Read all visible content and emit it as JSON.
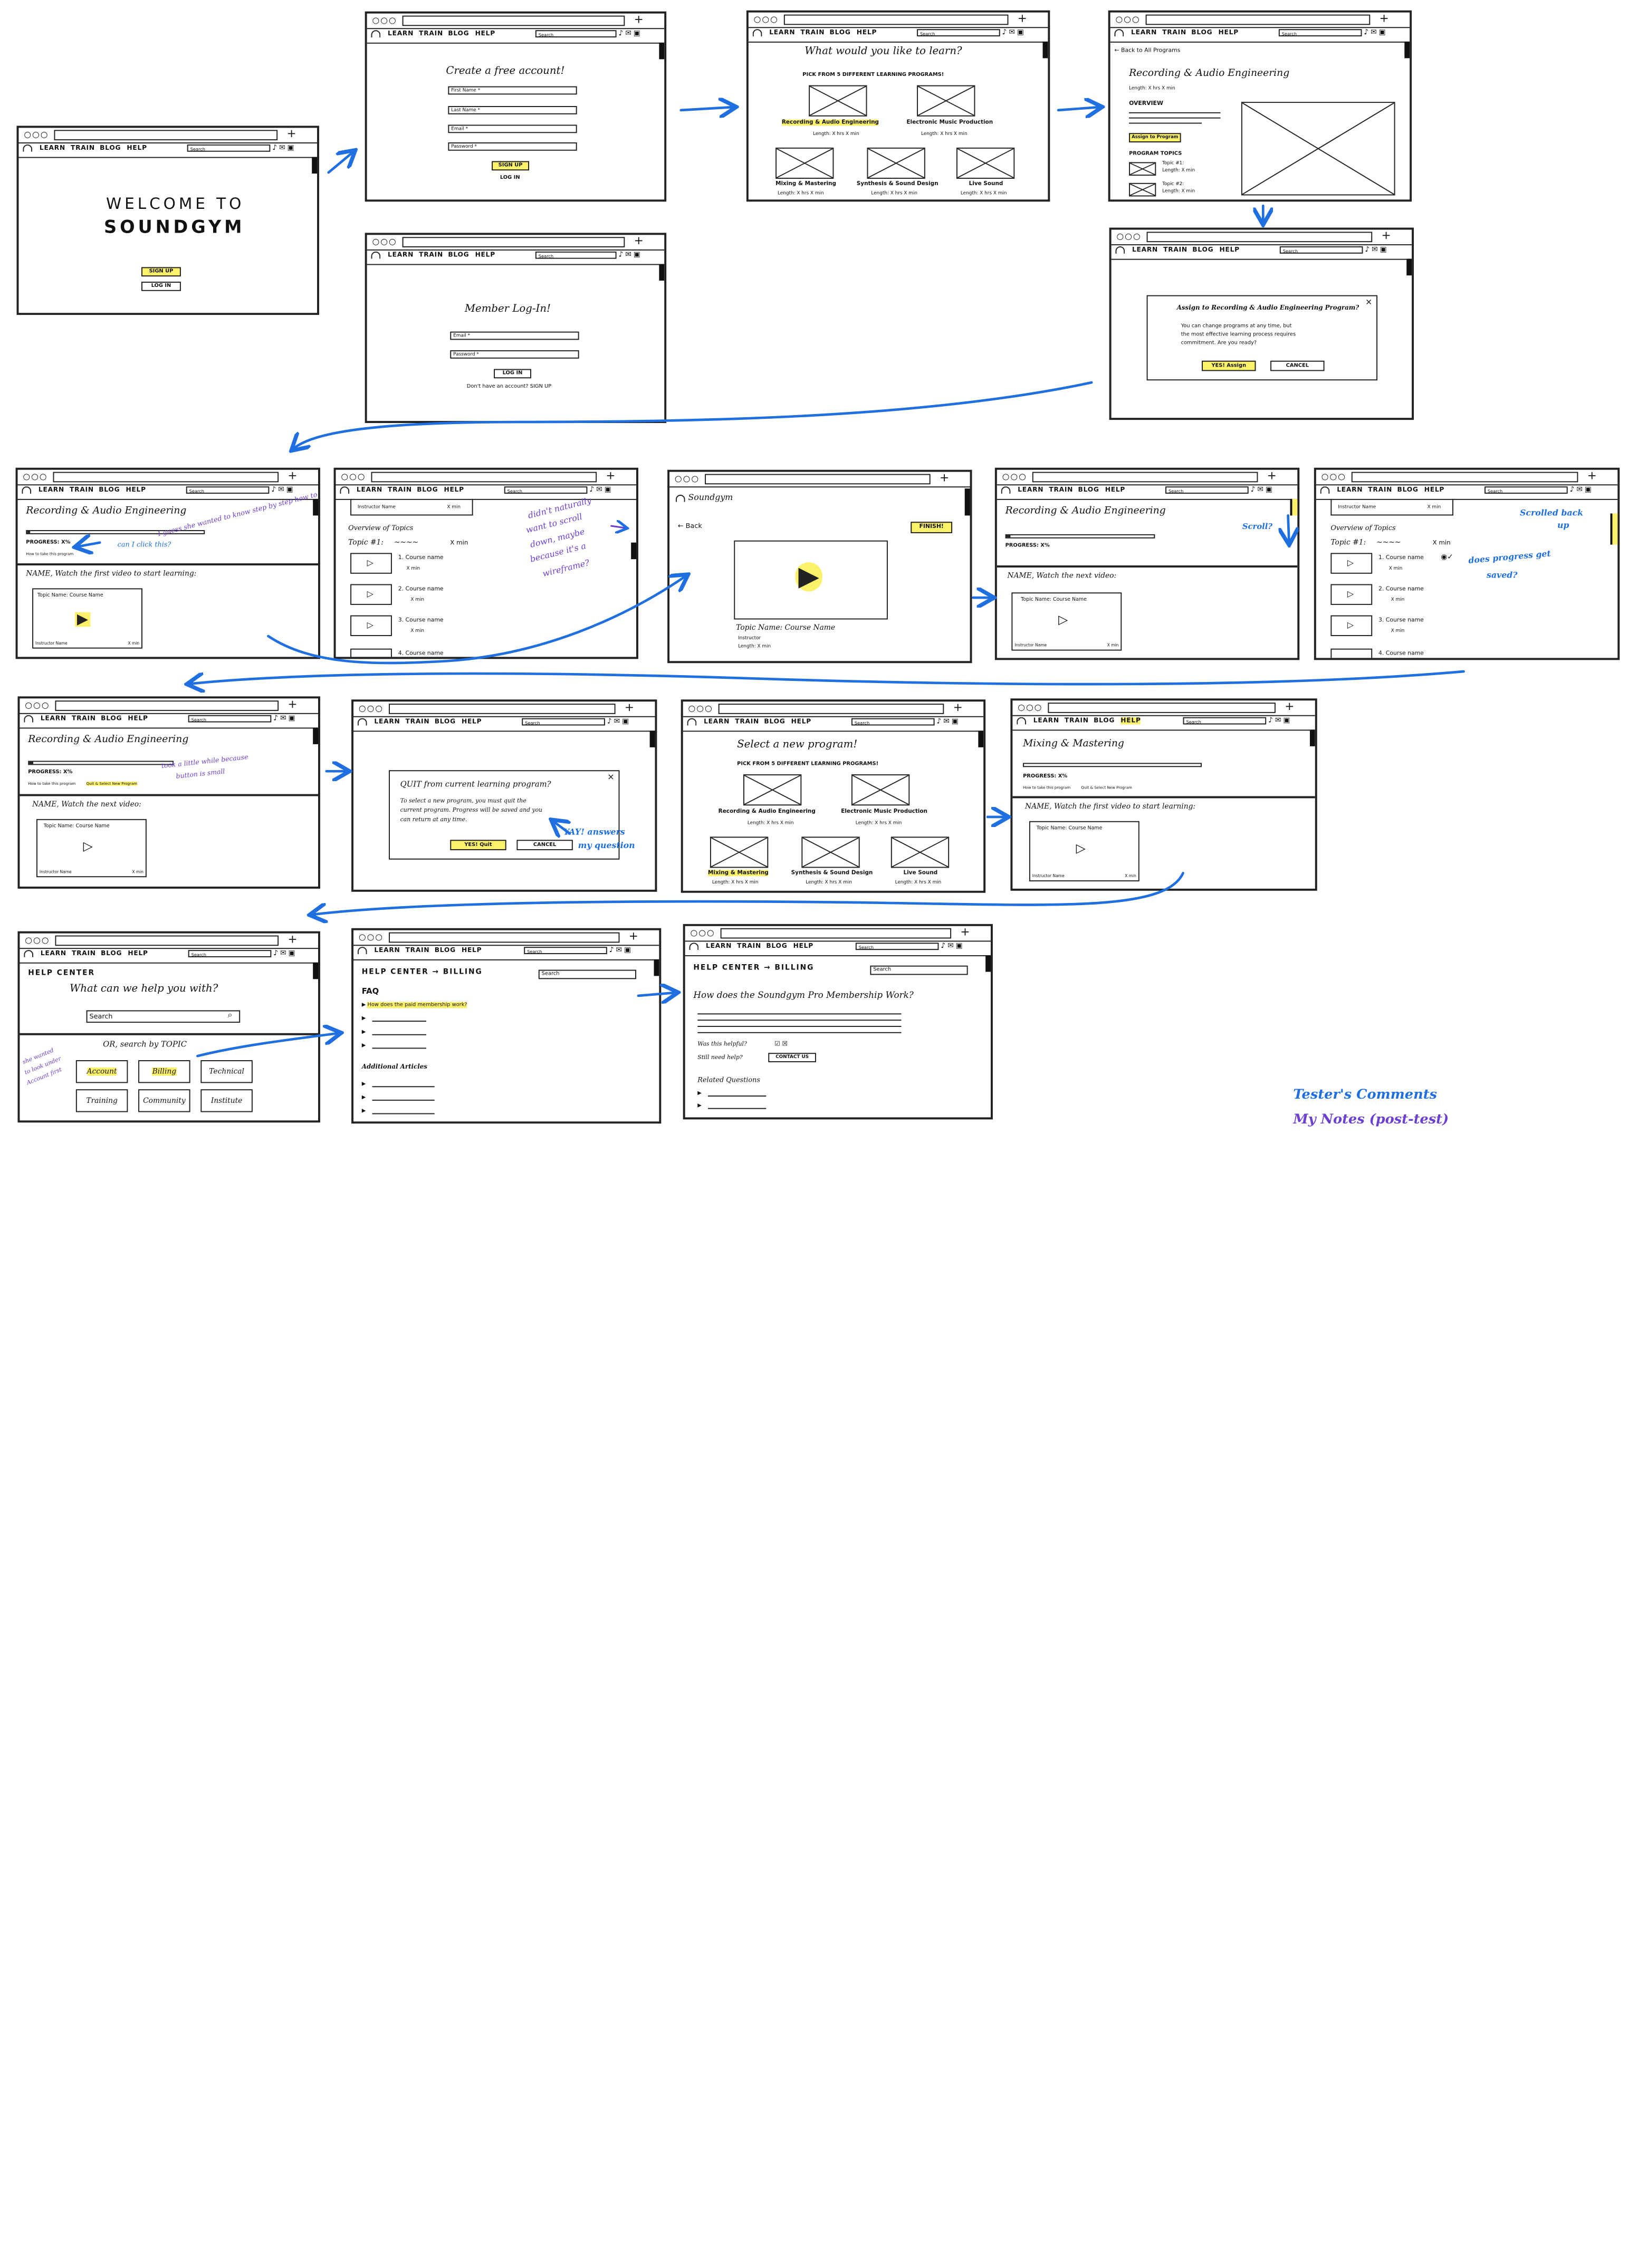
{
  "nav": {
    "learn": "LEARN",
    "train": "TRAIN",
    "blog": "BLOG",
    "help": "HELP",
    "search": "Search"
  },
  "s1": {
    "welcome": "WELCOME TO",
    "brand": "SOUNDGYM",
    "signup": "SIGN UP",
    "login": "LOG IN"
  },
  "s2": {
    "title": "Create a free account!",
    "first": "First Name *",
    "last": "Last Name *",
    "email": "Email *",
    "password": "Password *",
    "signup": "SIGN UP",
    "login": "LOG IN"
  },
  "s3": {
    "title": "Member Log-In!",
    "email": "Email *",
    "password": "Password *",
    "login": "LOG IN",
    "noacct": "Don't have an account? SIGN UP"
  },
  "s4": {
    "title": "What would you like to learn?",
    "subtitle": "PICK FROM 5 DIFFERENT LEARNING PROGRAMS!",
    "p1": "Recording & Audio Engineering",
    "p2": "Electronic Music Production",
    "p3": "Mixing & Mastering",
    "p4": "Synthesis & Sound Design",
    "p5": "Live Sound",
    "length": "Length: X hrs X min"
  },
  "s5": {
    "back": "Back to All Programs",
    "title": "Recording & Audio Engineering",
    "length": "Length: X hrs X min",
    "overview": "OVERVIEW",
    "assign": "Assign to Program",
    "topics": "PROGRAM TOPICS",
    "t1": "Topic #1:",
    "t2": "Topic #2:",
    "tlen": "Length: X min"
  },
  "s6": {
    "title": "Assign to Recording & Audio Engineering Program?",
    "body1": "You can change programs at any time, but",
    "body2": "the most effective learning process requires",
    "body3": "commitment. Are you ready?",
    "yes": "YES! Assign",
    "cancel": "CANCEL"
  },
  "s7": {
    "title": "Recording & Audio Engineering",
    "progress": "PROGRESS: X%",
    "howto": "How to take this program",
    "watch": "NAME, Watch the first video to start learning:",
    "card": "Topic Name: Course Name",
    "instructor": "Instructor Name",
    "xmin": "X min",
    "c1": "can I click this?",
    "c2": "I guess she wanted to know step by step how to take?"
  },
  "s8": {
    "instructor": "Instructor Name",
    "xmin": "X min",
    "overview": "Overview of Topics",
    "topic": "Topic #1:",
    "cn1": "1. Course name",
    "cn2": "2. Course name",
    "cn3": "3. Course name",
    "cn4": "4. Course name",
    "m1": "didn't naturally",
    "m2": "want to scroll",
    "m3": "down, maybe",
    "m4": "because it's a",
    "m5": "wireframe?"
  },
  "s9": {
    "brand": "Soundgym",
    "back": "Back",
    "finish": "FINISH!",
    "topic": "Topic Name: Course Name",
    "instructor": "Instructor",
    "length": "Length: X min"
  },
  "s10": {
    "title": "Recording & Audio Engineering",
    "progress": "PROGRESS: X%",
    "watch": "NAME, Watch the next video:",
    "card": "Topic Name: Course Name",
    "c1": "Scroll?"
  },
  "s11": {
    "c1": "Scrolled back",
    "c2": "up",
    "c3": "does progress get",
    "c4": "saved?"
  },
  "s12": {
    "title": "Recording & Audio Engineering",
    "progress": "PROGRESS: X%",
    "howto": "How to take this program",
    "quit": "Quit & Select New Program",
    "watch": "NAME, Watch the next video:",
    "card": "Topic Name: Course Name",
    "m1": "took a little while because",
    "m2": "button is small"
  },
  "s13": {
    "title": "QUIT from current learning program?",
    "b1": "To select a new program, you must quit the",
    "b2": "current program. Progress will be saved and you",
    "b3": "can return at any time.",
    "yes": "YES! Quit",
    "cancel": "CANCEL",
    "c1": "YAY! answers",
    "c2": "my question"
  },
  "s14": {
    "title": "Select a new program!",
    "subtitle": "PICK FROM 5 DIFFERENT LEARNING PROGRAMS!"
  },
  "s15": {
    "title": "Mixing & Mastering",
    "progress": "PROGRESS: X%",
    "watch": "NAME, Watch the first video to start learning:"
  },
  "s16": {
    "center": "HELP CENTER",
    "q": "What can we help you with?",
    "search": "Search",
    "or": "OR, search by TOPIC",
    "account": "Account",
    "billing": "Billing",
    "technical": "Technical",
    "training": "Training",
    "community": "Community",
    "institute": "Institute",
    "c1": "she wanted",
    "c2": "to look under",
    "c3": "Account first"
  },
  "s17": {
    "crumb": "HELP CENTER → BILLING",
    "faq": "FAQ",
    "q1": "How does the paid membership work?",
    "additional": "Additional Articles",
    "search": "Search"
  },
  "s18": {
    "crumb": "HELP CENTER → BILLING",
    "title": "How does the Soundgym Pro Membership Work?",
    "helpful": "Was this helpful?",
    "need": "Still need help?",
    "contact": "CONTACT US",
    "related": "Related Questions",
    "search": "Search"
  },
  "legend": {
    "tester": "Tester's Comments",
    "notes": "My Notes (post-test)",
    "tester_color": "#1f6fe0",
    "notes_color": "#6b3fd0"
  },
  "colors": {
    "highlight": "#fbf16a",
    "ink": "#222222"
  }
}
